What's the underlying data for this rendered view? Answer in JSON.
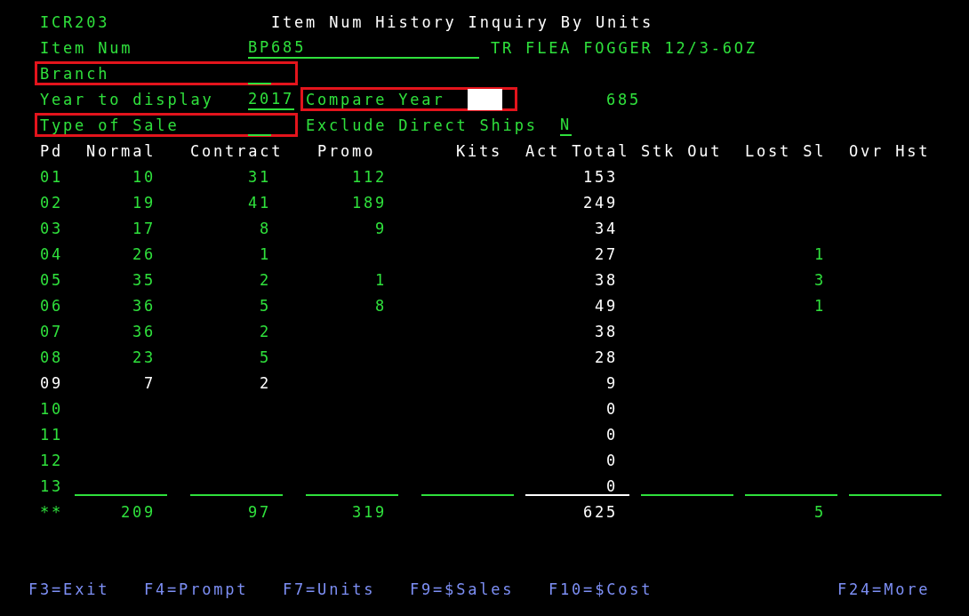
{
  "header": {
    "program": "ICR203",
    "title": "Item Num History Inquiry By Units"
  },
  "item": {
    "label": "Item Num",
    "value": "BP685",
    "description": "TR FLEA FOGGER 12/3-6OZ"
  },
  "branch": {
    "label": "Branch",
    "annotated": true
  },
  "year": {
    "label": "Year to display",
    "value": "2017"
  },
  "compare_year": {
    "label": "Compare Year",
    "annotated": true,
    "code": "685"
  },
  "type_of_sale": {
    "label": "Type of Sale",
    "annotated": true
  },
  "exclude_direct_ships": {
    "label": "Exclude Direct Ships",
    "value": "N"
  },
  "table": {
    "columns": [
      "Pd",
      "Normal",
      "Contract",
      "Promo",
      "Kits",
      "Act Total",
      "Stk Out",
      "Lost Sl",
      "Ovr Hst"
    ],
    "rows": [
      {
        "highlighted": false,
        "cells": [
          "01",
          "10",
          "31",
          "112",
          null,
          "153",
          null,
          null,
          null
        ]
      },
      {
        "highlighted": false,
        "cells": [
          "02",
          "19",
          "41",
          "189",
          null,
          "249",
          null,
          null,
          null
        ]
      },
      {
        "highlighted": false,
        "cells": [
          "03",
          "17",
          "8",
          "9",
          null,
          "34",
          null,
          null,
          null
        ]
      },
      {
        "highlighted": false,
        "cells": [
          "04",
          "26",
          "1",
          null,
          null,
          "27",
          null,
          "1",
          null
        ]
      },
      {
        "highlighted": false,
        "cells": [
          "05",
          "35",
          "2",
          "1",
          null,
          "38",
          null,
          "3",
          null
        ]
      },
      {
        "highlighted": false,
        "cells": [
          "06",
          "36",
          "5",
          "8",
          null,
          "49",
          null,
          "1",
          null
        ]
      },
      {
        "highlighted": false,
        "cells": [
          "07",
          "36",
          "2",
          null,
          null,
          "38",
          null,
          null,
          null
        ]
      },
      {
        "highlighted": false,
        "cells": [
          "08",
          "23",
          "5",
          null,
          null,
          "28",
          null,
          null,
          null
        ]
      },
      {
        "highlighted": true,
        "cells": [
          "09",
          "7",
          "2",
          null,
          null,
          "9",
          null,
          null,
          null
        ]
      },
      {
        "highlighted": false,
        "cells": [
          "10",
          null,
          null,
          null,
          null,
          "0",
          null,
          null,
          null
        ]
      },
      {
        "highlighted": false,
        "cells": [
          "11",
          null,
          null,
          null,
          null,
          "0",
          null,
          null,
          null
        ]
      },
      {
        "highlighted": false,
        "cells": [
          "12",
          null,
          null,
          null,
          null,
          "0",
          null,
          null,
          null
        ]
      },
      {
        "highlighted": false,
        "cells": [
          "13",
          null,
          null,
          null,
          null,
          "0",
          null,
          null,
          null
        ]
      },
      {
        "highlighted": false,
        "kind": "totals",
        "cells": [
          "**",
          "209",
          "97",
          "319",
          null,
          "625",
          null,
          "5",
          null
        ]
      }
    ]
  },
  "function_keys": [
    "F3=Exit",
    "F4=Prompt",
    "F7=Units",
    "F9=$Sales",
    "F10=$Cost",
    "F24=More"
  ]
}
